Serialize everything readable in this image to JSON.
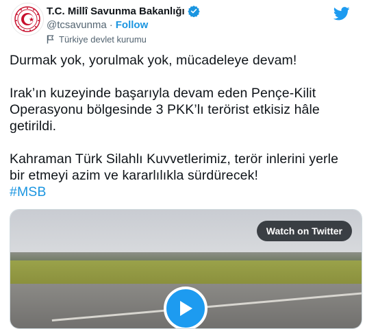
{
  "account": {
    "display_name": "T.C. Millî Savunma Bakanlığı",
    "handle": "@tcsavunma",
    "separator": "·",
    "follow_label": "Follow",
    "label": "Türkiye devlet kurumu"
  },
  "tweet": {
    "line1": "Durmak yok, yorulmak yok, mücadeleye devam!",
    "para2": "Irak’ın kuzeyinde başarıyla devam eden Pençe-Kilit Operasyonu bölgesinde 3 PKK’lı terörist etkisiz hâle getirildi.",
    "para3": "Kahraman Türk Silahlı Kuvvetlerimiz, terör inlerini yerle bir etmeyi azim ve kararlılıkla sürdürecek!",
    "hashtag": "#MSB"
  },
  "media": {
    "watch_label": "Watch on Twitter"
  },
  "icons": {
    "verified": "verified-badge-icon",
    "twitter": "twitter-bird-icon",
    "label": "flag-icon",
    "play": "play-icon",
    "avatar": "ministry-emblem-icon"
  },
  "colors": {
    "accent": "#1b95e0",
    "text": "#0f1419",
    "secondary": "#536471",
    "emblem_red": "#c8102e"
  }
}
